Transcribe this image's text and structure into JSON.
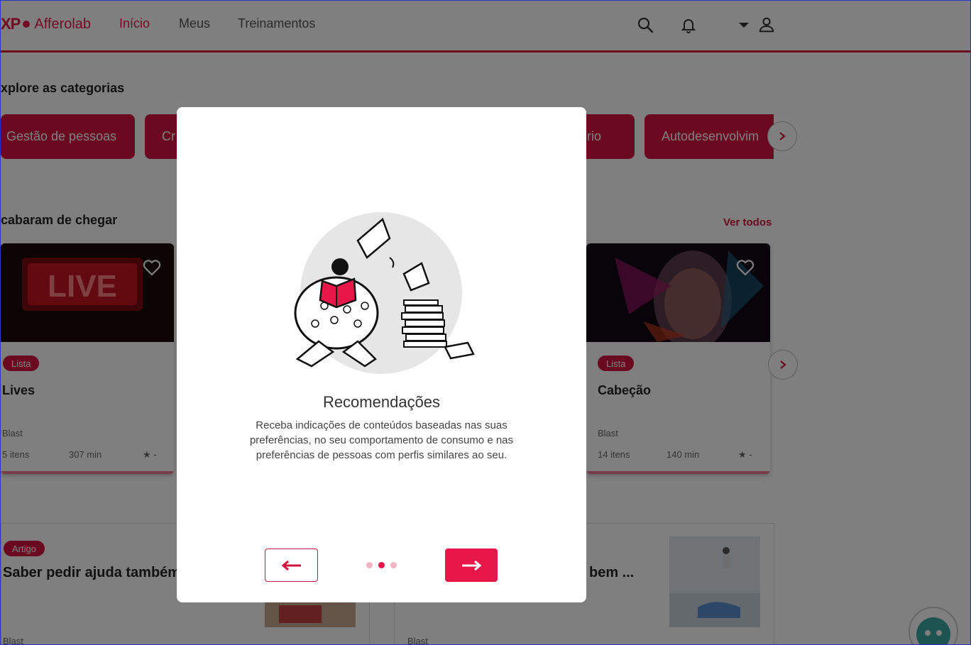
{
  "header": {
    "logo_xp": "XP",
    "logo_brand": "Afferolab",
    "nav": [
      "Início",
      "Meus",
      "Treinamentos"
    ]
  },
  "categories": {
    "title": "xplore as categorias",
    "items": [
      "Gestão de pessoas",
      "Cr",
      "rio",
      "Autodesenvolvim"
    ]
  },
  "recent": {
    "title": "cabaram de chegar",
    "see_all": "Ver todos",
    "cards": [
      {
        "badge": "Lista",
        "title": "Lives",
        "source": "Blast",
        "items": "5 itens",
        "duration": "307 min",
        "rating": "★ -",
        "thumb_text": "LIVE"
      },
      {
        "badge": "Lista",
        "title": "Cabeção",
        "source": "Blast",
        "items": "14 itens",
        "duration": "140 min",
        "rating": "★ -"
      }
    ]
  },
  "articles": [
    {
      "badge": "Artigo",
      "title": "Saber pedir ajuda também",
      "source": "Blast"
    },
    {
      "title": "bem ...",
      "source": "Blast"
    }
  ],
  "modal": {
    "title": "Recomendações",
    "description": "Receba indicações de conteúdos baseadas nas suas preferências, no seu comportamento de consumo e nas preferências de pessoas com perfis similares ao seu.",
    "step": 2,
    "total_steps": 3
  },
  "colors": {
    "accent": "#e8174a",
    "accent_dark": "#d4123f",
    "overlay": "rgba(0,0,0,0.5)"
  }
}
